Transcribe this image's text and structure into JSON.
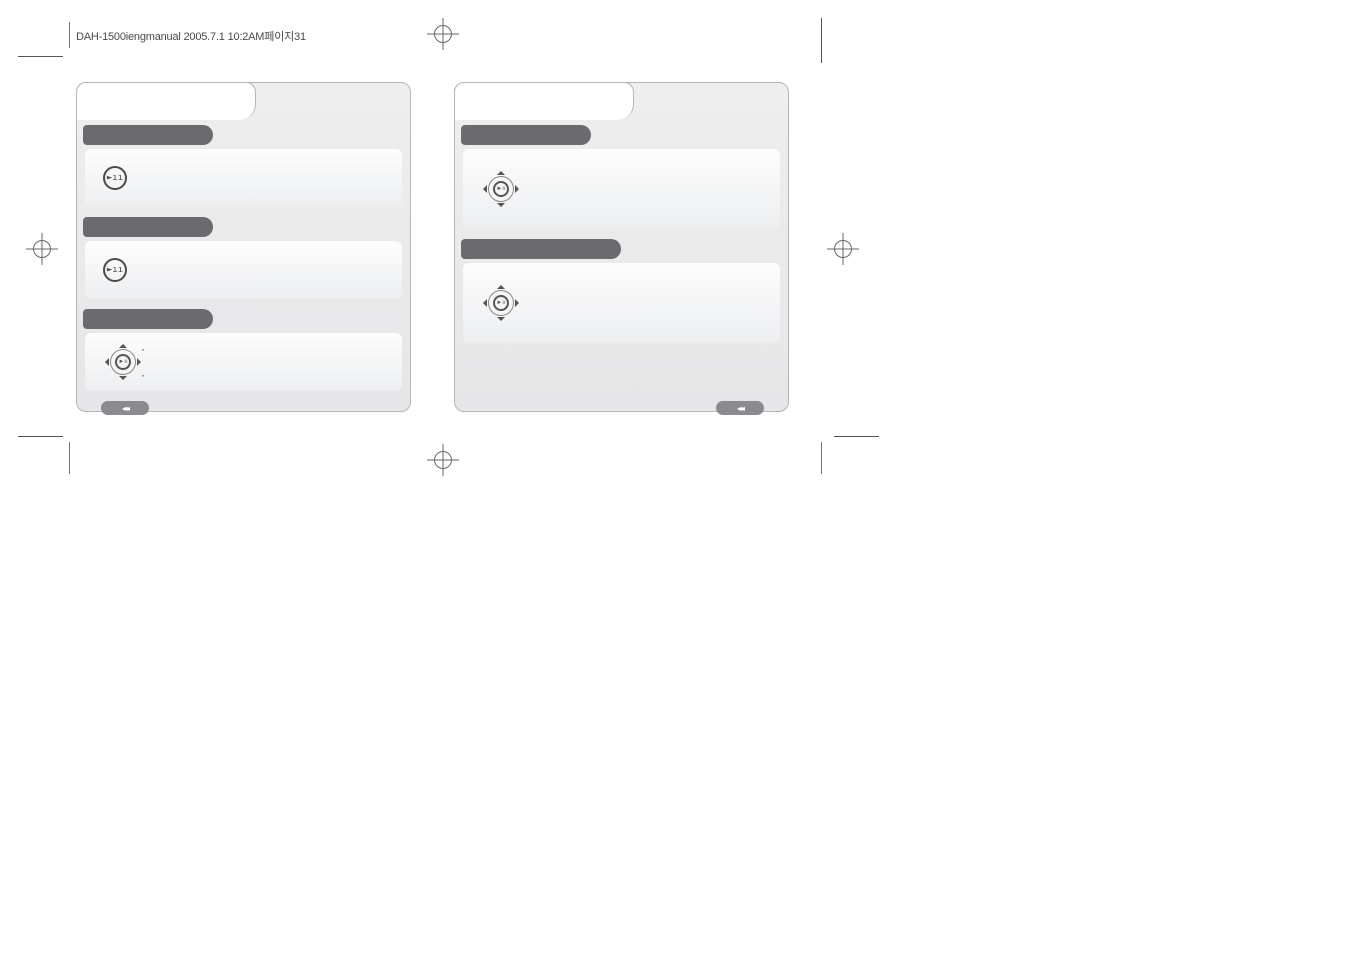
{
  "header": {
    "doc_label": "DAH-1500iengmanual  2005.7.1 10:2AM페이지31"
  },
  "left_card": {
    "tab_label": "",
    "sections": [
      {
        "header": "",
        "icon": "play-pause",
        "body": ""
      },
      {
        "header": "",
        "icon": "play-pause",
        "body": ""
      },
      {
        "header": "",
        "icon": "nav-cluster",
        "body": "",
        "bullets": [
          "·",
          "·"
        ]
      }
    ],
    "footer_glyphs": "◂◂◂"
  },
  "right_card": {
    "tab_label": "",
    "sections": [
      {
        "header": "",
        "icon": "nav-cluster",
        "body": ""
      },
      {
        "header": "",
        "icon": "nav-cluster",
        "body": ""
      }
    ],
    "footer_glyphs": "◂◂◂"
  }
}
